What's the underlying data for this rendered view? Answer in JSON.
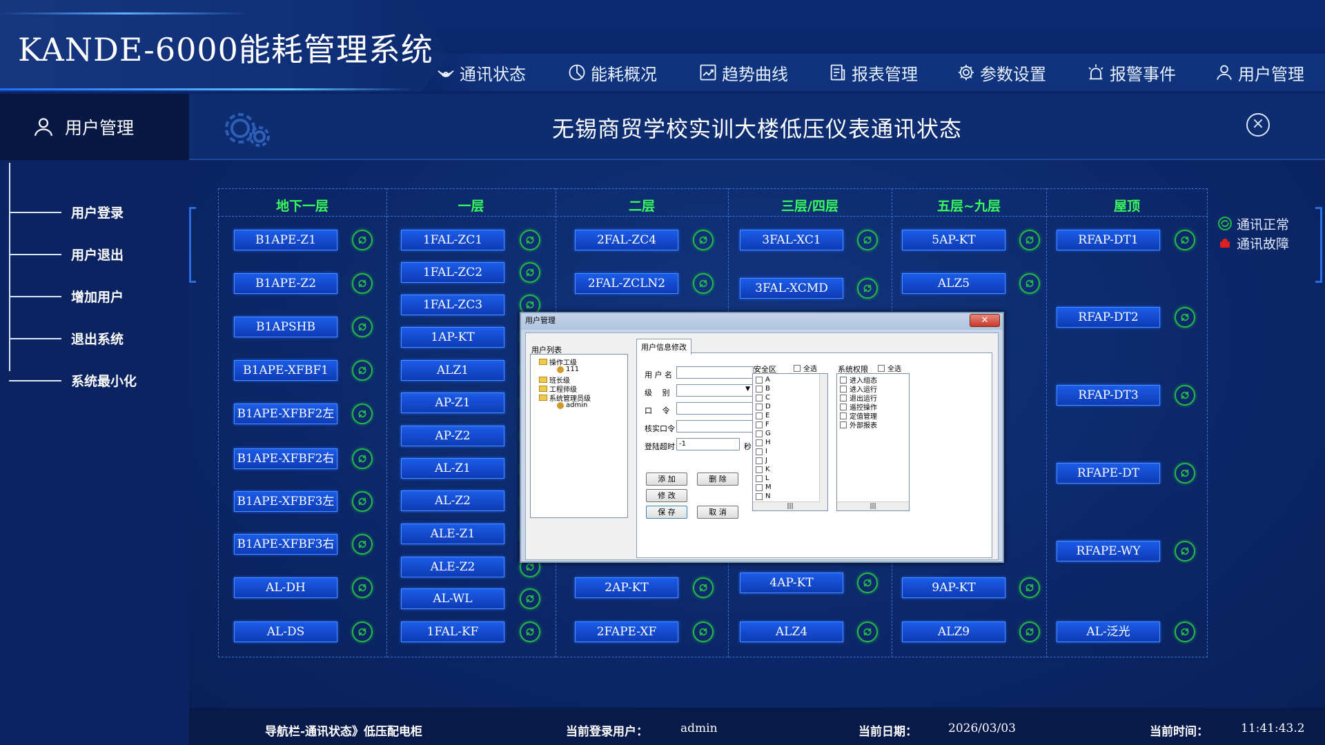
{
  "app_title": "KANDE-6000能耗管理系统",
  "nav": [
    {
      "label": "通讯状态",
      "icon": "signal-icon"
    },
    {
      "label": "能耗概况",
      "icon": "pie-icon"
    },
    {
      "label": "趋势曲线",
      "icon": "trend-icon"
    },
    {
      "label": "报表管理",
      "icon": "report-icon"
    },
    {
      "label": "参数设置",
      "icon": "gear-icon"
    },
    {
      "label": "报警事件",
      "icon": "alarm-icon"
    },
    {
      "label": "用户管理",
      "icon": "user-icon"
    }
  ],
  "sidebar": {
    "title": "用户管理",
    "items": [
      "用户登录",
      "用户退出",
      "增加用户",
      "退出系统",
      "系统最小化"
    ]
  },
  "page_title": "无锡商贸学校实训大楼低压仪表通讯状态",
  "close_label": "×",
  "columns": [
    {
      "header": "地下一层",
      "meters": [
        "B1APE-Z1",
        "B1APE-Z2",
        "B1APSHB",
        "B1APE-XFBF1",
        "B1APE-XFBF2左",
        "B1APE-XFBF2右",
        "B1APE-XFBF3左",
        "B1APE-XFBF3右",
        "AL-DH",
        "AL-DS"
      ]
    },
    {
      "header": "一层",
      "meters": [
        "1FAL-ZC1",
        "1FAL-ZC2",
        "1FAL-ZC3",
        "1AP-KT",
        "ALZ1",
        "AP-Z1",
        "AP-Z2",
        "AL-Z1",
        "AL-Z2",
        "ALE-Z1",
        "ALE-Z2",
        "AL-WL",
        "1FAL-KF"
      ]
    },
    {
      "header": "二层",
      "meters": [
        "2FAL-ZC4",
        "2FAL-ZCLN2",
        "2AP-KT",
        "2FAPE-XF"
      ]
    },
    {
      "header": "三层/四层",
      "meters": [
        "3FAL-XC1",
        "3FAL-XCMD",
        "4AP-KT",
        "ALZ4"
      ]
    },
    {
      "header": "五层~九层",
      "meters": [
        "5AP-KT",
        "ALZ5",
        "9AP-KT",
        "ALZ9"
      ]
    },
    {
      "header": "屋顶",
      "meters": [
        "RFAP-DT1",
        "RFAP-DT2",
        "RFAP-DT3",
        "RFAPE-DT",
        "RFAPE-WY",
        "AL-泛光"
      ]
    }
  ],
  "legend": {
    "normal": "通讯正常",
    "fault": "通讯故障",
    "normal_color": "#25b84a",
    "fault_color": "#e02020"
  },
  "dialog": {
    "title": "用户管理",
    "close": "✕",
    "user_list_label": "用户列表",
    "tab": "用户信息修改",
    "tree": [
      {
        "label": "操作工级",
        "level": 0
      },
      {
        "label": "111",
        "level": 1
      },
      {
        "label": "班长级",
        "level": 0
      },
      {
        "label": "工程师级",
        "level": 0
      },
      {
        "label": "系统管理员级",
        "level": 0
      },
      {
        "label": "admin",
        "level": 1
      }
    ],
    "fields": {
      "username": "用 户 名",
      "level": "级　 别",
      "password": "口　 令",
      "confirm": "核实口令",
      "timeout": "登陆超时",
      "timeout_value": "-1",
      "sec": "秒"
    },
    "buttons": {
      "add": "添 加",
      "delete": "删 除",
      "modify": "修 改",
      "save": "保 存",
      "cancel": "取 消"
    },
    "security": {
      "label": "安全区",
      "select_all": "全选",
      "items": [
        "A",
        "B",
        "C",
        "D",
        "E",
        "F",
        "G",
        "H",
        "I",
        "J",
        "K",
        "L",
        "M",
        "N"
      ]
    },
    "perm": {
      "label": "系统权限",
      "select_all": "全选",
      "items": [
        "进入组态",
        "进入运行",
        "退出运行",
        "遥控操作",
        "定值管理",
        "外部报表"
      ]
    },
    "scroll_thumb": "|||"
  },
  "footer": {
    "nav_path": "导航栏-通讯状态》低压配电柜",
    "user_label": "当前登录用户：",
    "user": "admin",
    "date_label": "当前日期：",
    "date": "2026/03/03",
    "time_label": "当前时间：",
    "time": "11:41:43.2"
  }
}
